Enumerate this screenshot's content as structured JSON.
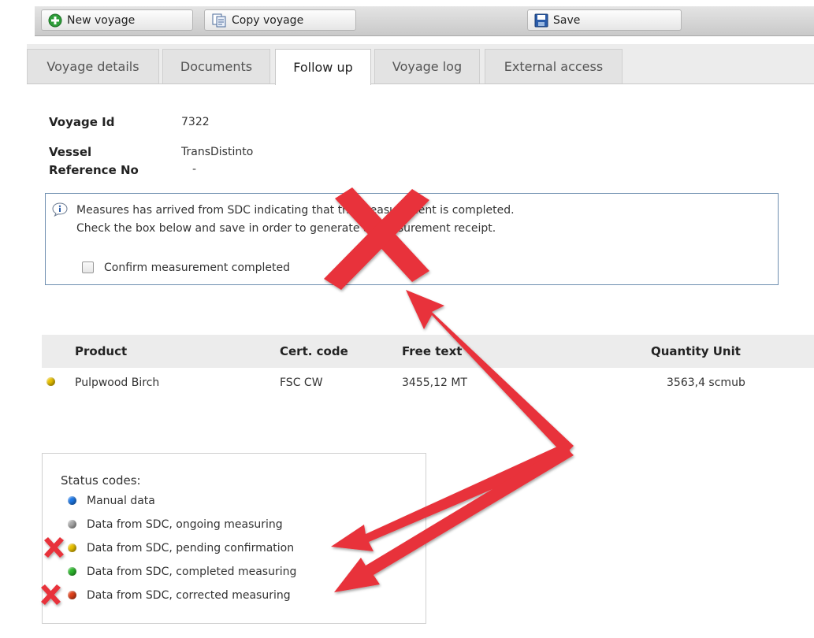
{
  "toolbar": {
    "new_voyage": "New voyage",
    "copy_voyage": "Copy voyage",
    "save": "Save"
  },
  "tabs": [
    {
      "label": "Voyage details",
      "active": false
    },
    {
      "label": "Documents",
      "active": false
    },
    {
      "label": "Follow up",
      "active": true
    },
    {
      "label": "Voyage log",
      "active": false
    },
    {
      "label": "External access",
      "active": false
    }
  ],
  "fields": {
    "voyage_id_label": "Voyage Id",
    "voyage_id": "7322",
    "vessel_label": "Vessel",
    "vessel": "TransDistinto",
    "reference_no_label": "Reference No",
    "reference_no": "-"
  },
  "info": {
    "line1": "Measures has arrived from SDC indicating that the measurement is completed.",
    "line2": "Check the box below and save in order to generate a measurement receipt.",
    "checkbox_label": "Confirm measurement completed",
    "checkbox_checked": false
  },
  "table": {
    "headers": [
      "Product",
      "Cert. code",
      "Free text",
      "Quantity Unit"
    ],
    "rows": [
      {
        "status_color": "#e8c000",
        "product": "Pulpwood Birch",
        "cert_code": "FSC CW",
        "free_text": "3455,12 MT",
        "quantity_unit": "3563,4 scmub"
      }
    ]
  },
  "legend": {
    "title": "Status codes:",
    "items": [
      {
        "label": "Manual data",
        "color": "#1e78e6"
      },
      {
        "label": "Data from SDC, ongoing measuring",
        "color": "#a8a8a8"
      },
      {
        "label": "Data from SDC, pending confirmation",
        "color": "#e8c000"
      },
      {
        "label": "Data from SDC, completed measuring",
        "color": "#2eb82e"
      },
      {
        "label": "Data from SDC, corrected measuring",
        "color": "#e0401a"
      }
    ]
  },
  "colors": {
    "annotation_red": "#e8333a",
    "info_border": "#6f8fb0",
    "tab_active_bg": "#ffffff"
  }
}
